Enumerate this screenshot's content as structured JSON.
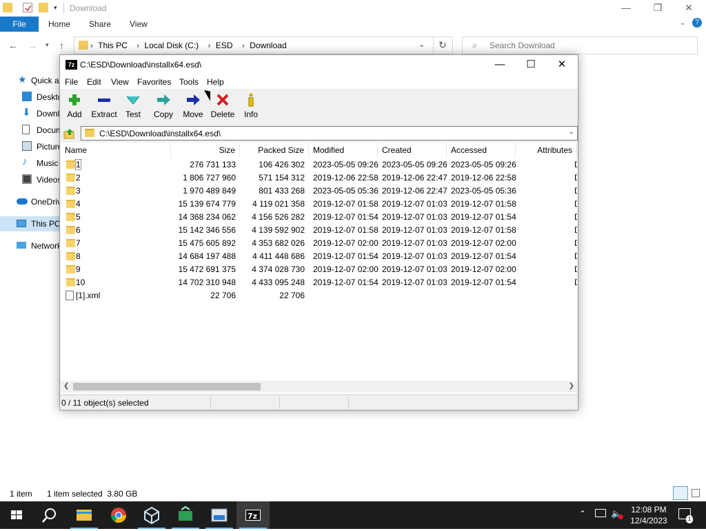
{
  "explorer": {
    "title": "Download",
    "ribbon_tabs": {
      "file": "File",
      "home": "Home",
      "share": "Share",
      "view": "View"
    },
    "breadcrumbs": [
      "This PC",
      "Local Disk (C:)",
      "ESD",
      "Download"
    ],
    "search_placeholder": "Search Download",
    "nav": [
      {
        "label": "Quick access",
        "icon": "star-icon"
      },
      {
        "label": "Desktop",
        "icon": "desktop-icon"
      },
      {
        "label": "Downloads",
        "icon": "download-icon"
      },
      {
        "label": "Documents",
        "icon": "document-icon"
      },
      {
        "label": "Pictures",
        "icon": "picture-icon"
      },
      {
        "label": "Music",
        "icon": "music-icon"
      },
      {
        "label": "Videos",
        "icon": "video-icon"
      },
      {
        "label": "OneDrive",
        "icon": "cloud-icon"
      },
      {
        "label": "This PC",
        "icon": "computer-icon"
      },
      {
        "label": "Network",
        "icon": "network-icon"
      }
    ],
    "status": {
      "items": "1 item",
      "selected": "1 item selected  3.80 GB"
    }
  },
  "zip": {
    "title": "C:\\ESD\\Download\\installx64.esd\\",
    "menu": [
      "File",
      "Edit",
      "View",
      "Favorites",
      "Tools",
      "Help"
    ],
    "toolbar": [
      {
        "label": "Add",
        "icon": "add-icon"
      },
      {
        "label": "Extract",
        "icon": "extract-icon"
      },
      {
        "label": "Test",
        "icon": "test-icon"
      },
      {
        "label": "Copy",
        "icon": "copy-icon"
      },
      {
        "label": "Move",
        "icon": "move-icon"
      },
      {
        "label": "Delete",
        "icon": "delete-icon"
      },
      {
        "label": "Info",
        "icon": "info-icon"
      }
    ],
    "path": "C:\\ESD\\Download\\installx64.esd\\",
    "columns": [
      "Name",
      "Size",
      "Packed Size",
      "Modified",
      "Created",
      "Accessed",
      "Attributes"
    ],
    "rows": [
      {
        "name": "1",
        "size": "276 731 133",
        "packed": "106 426 302",
        "modified": "2023-05-05 09:26",
        "created": "2023-05-05 09:26",
        "accessed": "2023-05-05 09:26",
        "type": "folder"
      },
      {
        "name": "2",
        "size": "1 806 727 960",
        "packed": "571 154 312",
        "modified": "2019-12-06 22:58",
        "created": "2019-12-06 22:47",
        "accessed": "2019-12-06 22:58",
        "type": "folder"
      },
      {
        "name": "3",
        "size": "1 970 489 849",
        "packed": "801 433 268",
        "modified": "2023-05-05 05:36",
        "created": "2019-12-06 22:47",
        "accessed": "2023-05-05 05:36",
        "type": "folder"
      },
      {
        "name": "4",
        "size": "15 139 674 779",
        "packed": "4 119 021 358",
        "modified": "2019-12-07 01:58",
        "created": "2019-12-07 01:03",
        "accessed": "2019-12-07 01:58",
        "type": "folder"
      },
      {
        "name": "5",
        "size": "14 368 234 062",
        "packed": "4 156 526 282",
        "modified": "2019-12-07 01:54",
        "created": "2019-12-07 01:03",
        "accessed": "2019-12-07 01:54",
        "type": "folder"
      },
      {
        "name": "6",
        "size": "15 142 346 556",
        "packed": "4 139 592 902",
        "modified": "2019-12-07 01:58",
        "created": "2019-12-07 01:03",
        "accessed": "2019-12-07 01:58",
        "type": "folder"
      },
      {
        "name": "7",
        "size": "15 475 605 892",
        "packed": "4 353 682 026",
        "modified": "2019-12-07 02:00",
        "created": "2019-12-07 01:03",
        "accessed": "2019-12-07 02:00",
        "type": "folder"
      },
      {
        "name": "8",
        "size": "14 684 197 488",
        "packed": "4 411 448 686",
        "modified": "2019-12-07 01:54",
        "created": "2019-12-07 01:03",
        "accessed": "2019-12-07 01:54",
        "type": "folder"
      },
      {
        "name": "9",
        "size": "15 472 691 375",
        "packed": "4 374 028 730",
        "modified": "2019-12-07 02:00",
        "created": "2019-12-07 01:03",
        "accessed": "2019-12-07 02:00",
        "type": "folder"
      },
      {
        "name": "10",
        "size": "14 702 310 948",
        "packed": "4 433 095 248",
        "modified": "2019-12-07 01:54",
        "created": "2019-12-07 01:03",
        "accessed": "2019-12-07 01:54",
        "type": "folder"
      },
      {
        "name": "[1].xml",
        "size": "22 706",
        "packed": "22 706",
        "modified": "",
        "created": "",
        "accessed": "",
        "type": "file"
      }
    ],
    "status": "0 / 11 object(s) selected"
  },
  "taskbar": {
    "apps": [
      "start-icon",
      "search-icon",
      "file-explorer-icon",
      "chrome-icon",
      "virtualbox-icon",
      "app-icon",
      "dism-icon",
      "7zip-icon"
    ],
    "time": "12:08 PM",
    "date": "12/4/2023"
  }
}
